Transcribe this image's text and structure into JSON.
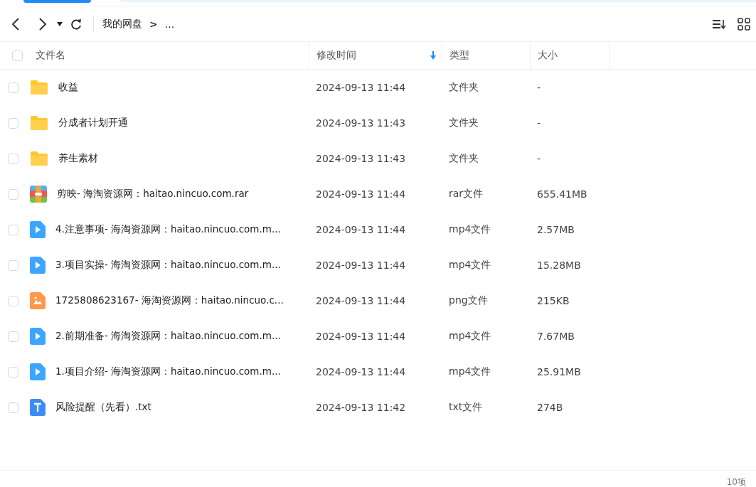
{
  "toolbar": {
    "breadcrumb": [
      "我的网盘",
      "..."
    ],
    "separator": ">"
  },
  "header": {
    "checked": false,
    "columns": [
      {
        "label": "文件名",
        "sorted": false
      },
      {
        "label": "修改时间",
        "sorted": true
      },
      {
        "label": "类型",
        "sorted": false
      },
      {
        "label": "大小",
        "sorted": false
      }
    ]
  },
  "rows": [
    {
      "kind": "folder",
      "name": "收益",
      "modified": "2024-09-13 11:44",
      "type": "文件夹",
      "size": "-",
      "checked": false
    },
    {
      "kind": "folder",
      "name": "分成者计划开通",
      "modified": "2024-09-13 11:43",
      "type": "文件夹",
      "size": "-",
      "checked": false
    },
    {
      "kind": "folder",
      "name": "养生素材",
      "modified": "2024-09-13 11:43",
      "type": "文件夹",
      "size": "-",
      "checked": false
    },
    {
      "kind": "archive",
      "name": "剪映- 海淘资源网：haitao.nincuo.com.rar",
      "modified": "2024-09-13 11:44",
      "type": "rar文件",
      "size": "655.41MB",
      "checked": false
    },
    {
      "kind": "video",
      "name": "4.注意事项- 海淘资源网：haitao.nincuo.com.m...",
      "modified": "2024-09-13 11:44",
      "type": "mp4文件",
      "size": "2.57MB",
      "checked": false
    },
    {
      "kind": "video",
      "name": "3.项目实操- 海淘资源网：haitao.nincuo.com.m...",
      "modified": "2024-09-13 11:44",
      "type": "mp4文件",
      "size": "15.28MB",
      "checked": false
    },
    {
      "kind": "image",
      "name": "1725808623167- 海淘资源网：haitao.nincuo.c...",
      "modified": "2024-09-13 11:44",
      "type": "png文件",
      "size": "215KB",
      "checked": false
    },
    {
      "kind": "video",
      "name": "2.前期准备- 海淘资源网：haitao.nincuo.com.m...",
      "modified": "2024-09-13 11:44",
      "type": "mp4文件",
      "size": "7.67MB",
      "checked": false
    },
    {
      "kind": "video",
      "name": "1.项目介绍- 海淘资源网：haitao.nincuo.com.m...",
      "modified": "2024-09-13 11:44",
      "type": "mp4文件",
      "size": "25.91MB",
      "checked": false
    },
    {
      "kind": "text",
      "name": "风险提醒（先看）.txt",
      "modified": "2024-09-13 11:42",
      "type": "txt文件",
      "size": "274B",
      "checked": false
    }
  ],
  "footer": {
    "count": "10项"
  }
}
